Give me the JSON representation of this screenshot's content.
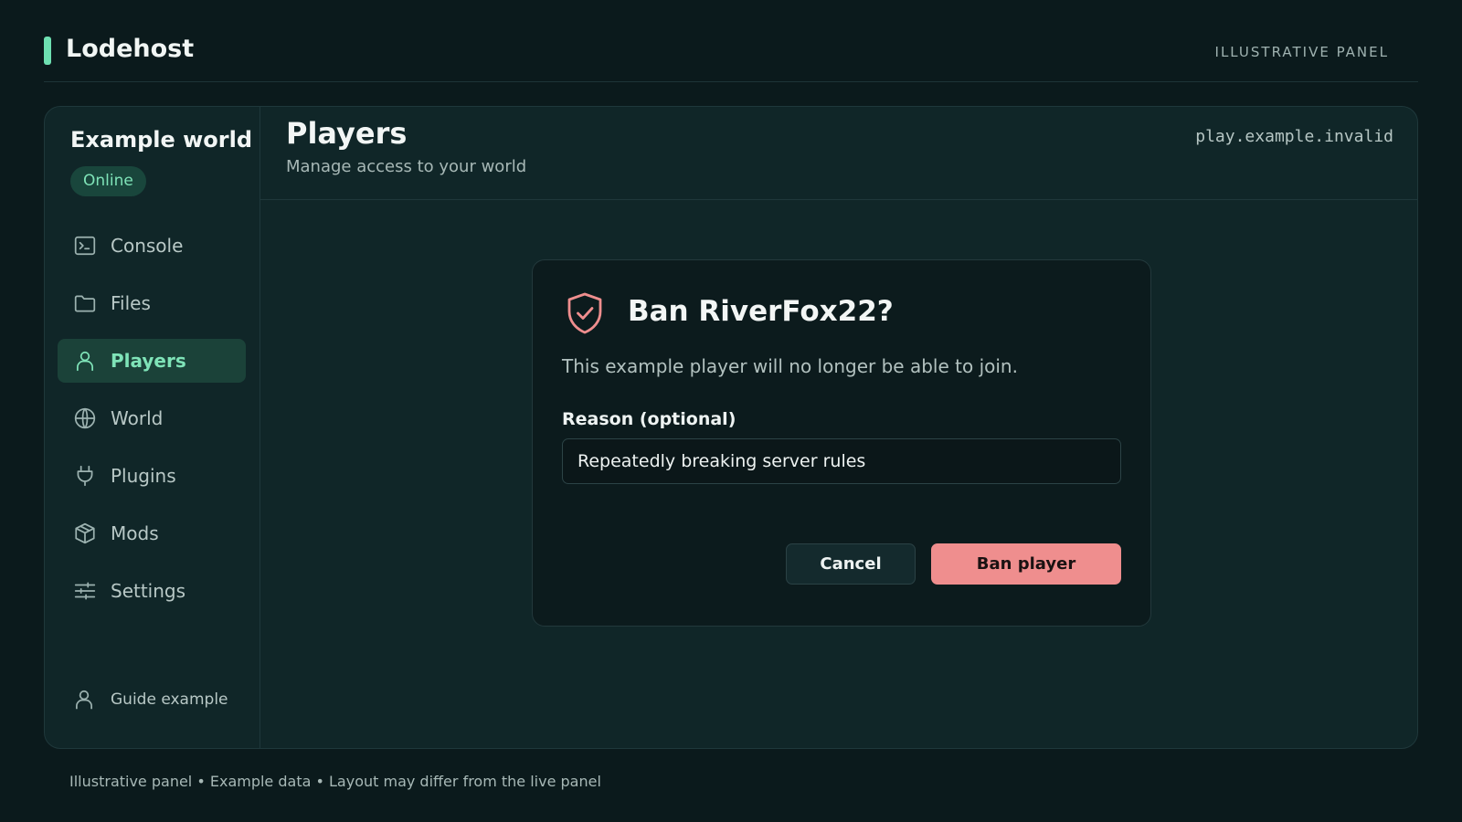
{
  "app": {
    "brand": "Lodehost",
    "top_note": "ILLUSTRATIVE PANEL",
    "accent_color": "#6ee0b1",
    "danger_color": "#ef8e8e"
  },
  "sidebar": {
    "world_name": "Example world",
    "status": "Online",
    "items": [
      {
        "label": "Console",
        "icon": "terminal-icon"
      },
      {
        "label": "Files",
        "icon": "folder-icon"
      },
      {
        "label": "Players",
        "icon": "user-icon",
        "active": true
      },
      {
        "label": "World",
        "icon": "globe-icon"
      },
      {
        "label": "Plugins",
        "icon": "plug-icon"
      },
      {
        "label": "Mods",
        "icon": "box-icon"
      },
      {
        "label": "Settings",
        "icon": "sliders-icon"
      }
    ],
    "user": "Guide example"
  },
  "header": {
    "title": "Players",
    "subtitle": "Manage access to your world",
    "address": "play.example.invalid"
  },
  "dialog": {
    "icon": "shield-check-icon",
    "title": "Ban RiverFox22?",
    "text": "This example player will no longer be able to join.",
    "field_label": "Reason (optional)",
    "field_value": "Repeatedly breaking server rules",
    "cancel_label": "Cancel",
    "confirm_label": "Ban player"
  },
  "footer": {
    "text": "Illustrative panel • Example data • Layout may differ from the live panel"
  }
}
